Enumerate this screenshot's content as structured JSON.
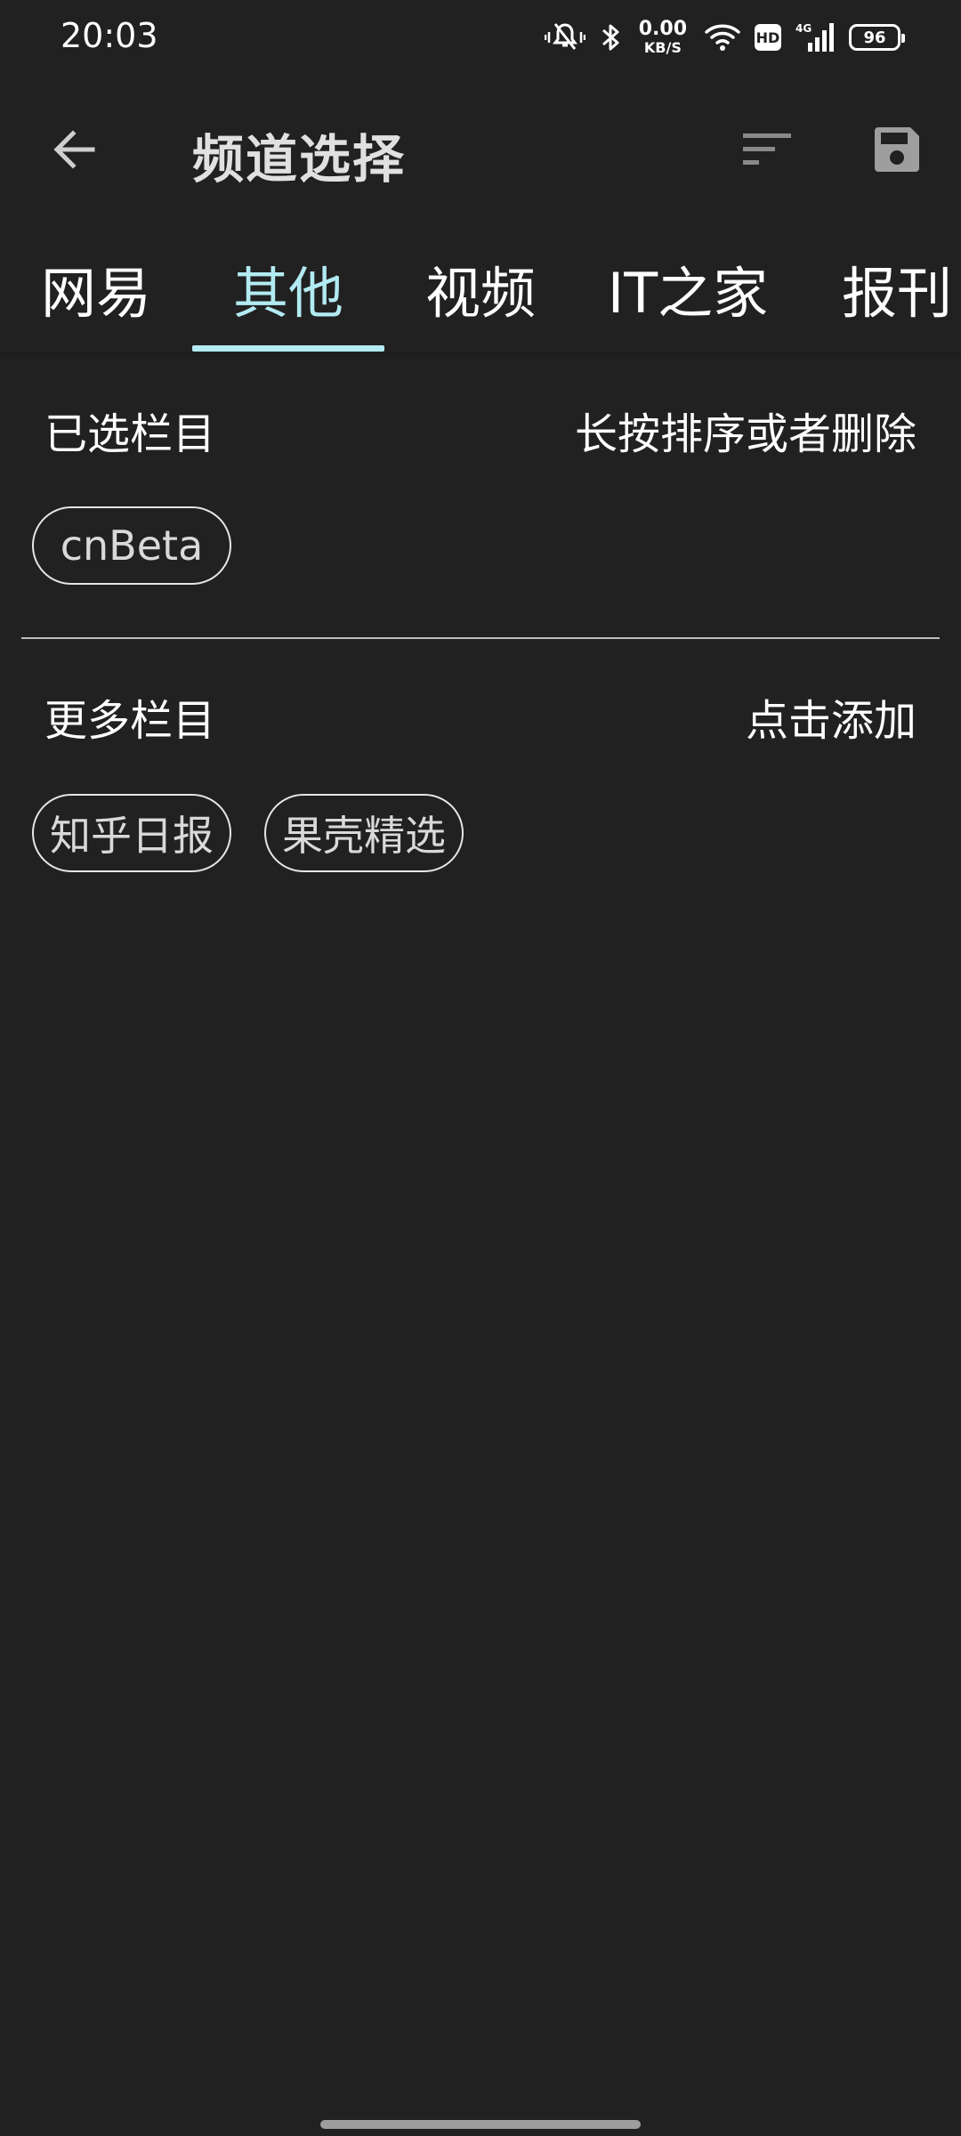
{
  "status_bar": {
    "time": "20:03",
    "net_speed_value": "0.00",
    "net_speed_unit": "KB/S",
    "hd_badge": "HD",
    "network_type": "4G",
    "battery_level": "96",
    "icons": [
      "mute-vibrate-icon",
      "bluetooth-icon",
      "wifi-icon",
      "hd-icon",
      "signal-icon",
      "battery-icon"
    ]
  },
  "app_bar": {
    "title": "频道选择",
    "back_icon": "arrow-back-icon",
    "sort_icon": "sort-icon",
    "save_icon": "save-icon"
  },
  "tabs": [
    {
      "label": "网易",
      "active": false
    },
    {
      "label": "其他",
      "active": true
    },
    {
      "label": "视频",
      "active": false
    },
    {
      "label": "IT之家",
      "active": false
    },
    {
      "label": "报刊",
      "active": false
    }
  ],
  "selected_section": {
    "title": "已选栏目",
    "hint": "长按排序或者删除",
    "chips": [
      "cnBeta"
    ]
  },
  "more_section": {
    "title": "更多栏目",
    "hint": "点击添加",
    "chips": [
      "知乎日报",
      "果壳精选"
    ]
  },
  "colors": {
    "background": "#212121",
    "accent": "#b2ebf2",
    "text": "#ffffff",
    "muted_icon": "#9e9e9e"
  }
}
